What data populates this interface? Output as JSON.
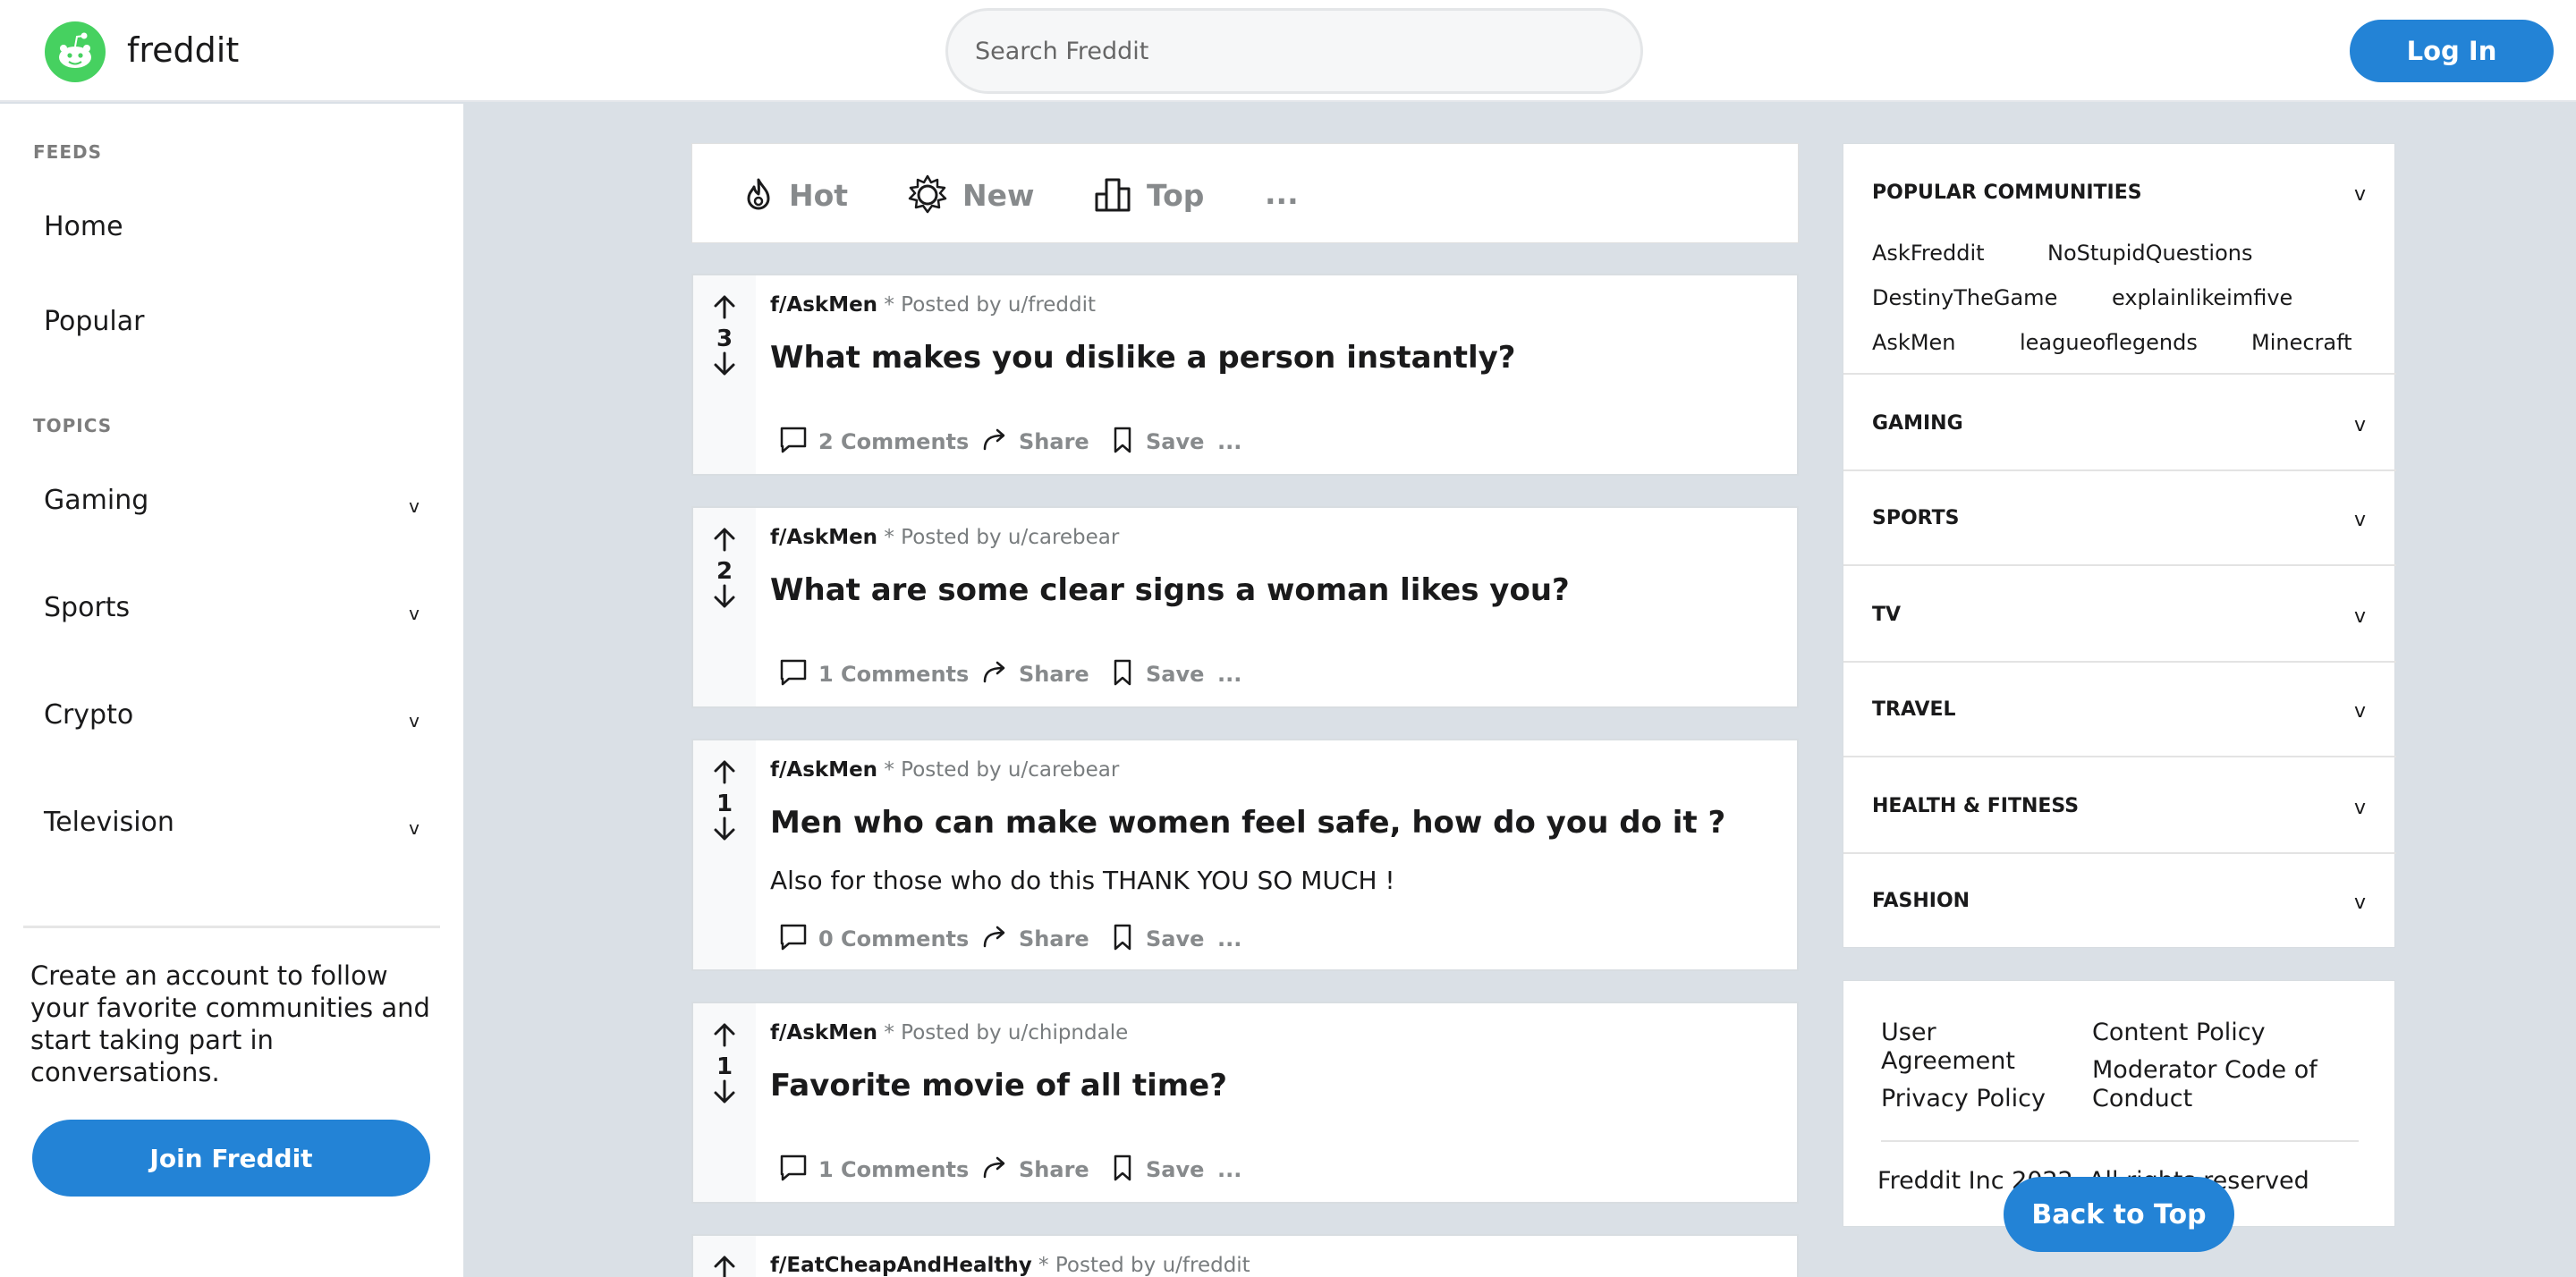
{
  "header": {
    "brand": "freddit",
    "search_placeholder": "Search Freddit",
    "login_label": "Log In"
  },
  "sidebar": {
    "feeds_label": "FEEDS",
    "feeds": [
      "Home",
      "Popular"
    ],
    "topics_label": "TOPICS",
    "topics": [
      "Gaming",
      "Sports",
      "Crypto",
      "Television"
    ],
    "chevron": "v",
    "cta_text": "Create an account to follow your favorite communities and start taking part in conversations.",
    "join_label": "Join Freddit"
  },
  "sort_bar": {
    "options": [
      {
        "label": "Hot",
        "icon": "flame-icon"
      },
      {
        "label": "New",
        "icon": "sun-icon"
      },
      {
        "label": "Top",
        "icon": "bar-chart-icon"
      }
    ],
    "more": "..."
  },
  "posts": [
    {
      "subreddit": "f/AskMen",
      "posted_by": "* Posted by u/freddit",
      "score": "3",
      "title": "What makes you dislike a person instantly?",
      "body": "",
      "comments": "2 Comments",
      "share": "Share",
      "save": "Save",
      "more": "..."
    },
    {
      "subreddit": "f/AskMen",
      "posted_by": "* Posted by u/carebear",
      "score": "2",
      "title": "What are some clear signs a woman likes you?",
      "body": "",
      "comments": "1 Comments",
      "share": "Share",
      "save": "Save",
      "more": "..."
    },
    {
      "subreddit": "f/AskMen",
      "posted_by": "* Posted by u/carebear",
      "score": "1",
      "title": "Men who can make women feel safe, how do you do it ?",
      "body": "Also for those who do this THANK YOU SO MUCH !",
      "comments": "0 Comments",
      "share": "Share",
      "save": "Save",
      "more": "..."
    },
    {
      "subreddit": "f/AskMen",
      "posted_by": "* Posted by u/chipndale",
      "score": "1",
      "title": "Favorite movie of all time?",
      "body": "",
      "comments": "1 Comments",
      "share": "Share",
      "save": "Save",
      "more": "..."
    },
    {
      "subreddit": "f/EatCheapAndHealthy",
      "posted_by": "* Posted by u/freddit"
    }
  ],
  "communities": {
    "popular_label": "POPULAR COMMUNITIES",
    "popular_links": [
      "AskFreddit",
      "NoStupidQuestions",
      "DestinyTheGame",
      "explainlikeimfive",
      "AskMen",
      "leagueoflegends",
      "Minecraft"
    ],
    "categories": [
      "GAMING",
      "SPORTS",
      "TV",
      "TRAVEL",
      "HEALTH & FITNESS",
      "FASHION"
    ],
    "chevron": "v"
  },
  "footer": {
    "links": [
      "User Agreement",
      "Privacy Policy",
      "Content Policy",
      "Moderator Code of Conduct"
    ],
    "copyright": "Freddit Inc 2022. All rights reserved",
    "back_to_top": "Back to Top"
  },
  "colors": {
    "accent": "#2383d6",
    "logo_green": "#46d160",
    "background": "#dae0e6"
  }
}
